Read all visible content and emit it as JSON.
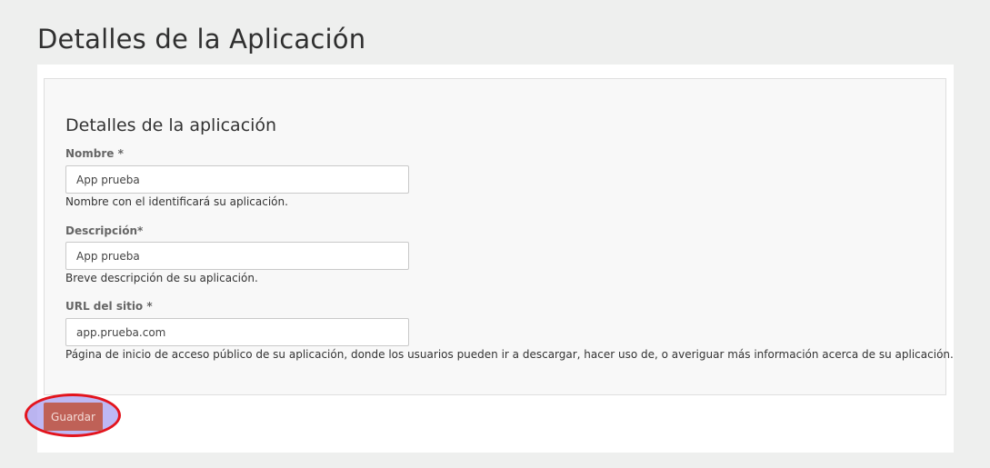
{
  "page": {
    "title": "Detalles de la Aplicación"
  },
  "form": {
    "section_title": "Detalles de la aplicación",
    "fields": [
      {
        "label": "Nombre *",
        "value": "App prueba",
        "help": "Nombre con el identificará su aplicación."
      },
      {
        "label": "Descripción*",
        "value": "App prueba",
        "help": "Breve descripción de su aplicación."
      },
      {
        "label": "URL del sitio *",
        "value": "app.prueba.com",
        "help": "Página de inicio de acceso público de su aplicación, donde los usuarios pueden ir a descargar, hacer uso de, o averiguar más información acerca de su aplicación."
      }
    ],
    "save_label": "Guardar"
  },
  "colors": {
    "background": "#eeefee",
    "panel": "#f8f8f8",
    "button": "#bf6157",
    "highlight_ring": "#e3141d",
    "highlight_fill": "#a8a0f0"
  }
}
